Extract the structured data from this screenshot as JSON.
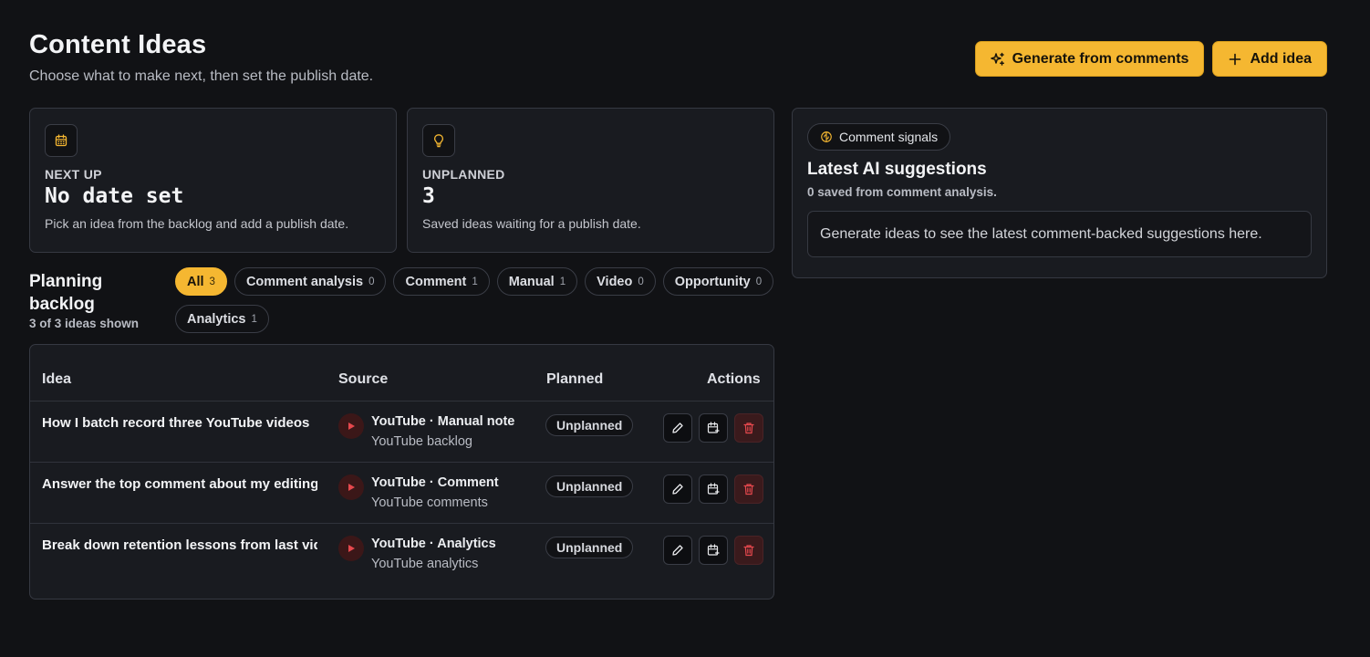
{
  "header": {
    "title": "Content Ideas",
    "subtitle": "Choose what to make next, then set the publish date.",
    "generate_label": "Generate from comments",
    "add_label": "Add idea"
  },
  "stats": [
    {
      "icon": "calendar-icon",
      "label": "NEXT UP",
      "value": "No date set",
      "desc": "Pick an idea from the backlog and add a publish date."
    },
    {
      "icon": "lightbulb-icon",
      "label": "UNPLANNED",
      "value": "3",
      "desc": "Saved ideas waiting for a publish date."
    }
  ],
  "ai": {
    "pill": "Comment signals",
    "title": "Latest AI suggestions",
    "subtitle": "0 saved from comment analysis.",
    "empty": "Generate ideas to see the latest comment-backed suggestions here."
  },
  "backlog": {
    "title": "Planning backlog",
    "count": "3 of 3 ideas shown",
    "filters": [
      {
        "label": "All",
        "count": "3",
        "active": true
      },
      {
        "label": "Comment analysis",
        "count": "0"
      },
      {
        "label": "Comment",
        "count": "1"
      },
      {
        "label": "Manual",
        "count": "1"
      },
      {
        "label": "Video",
        "count": "0"
      },
      {
        "label": "Opportunity",
        "count": "0"
      },
      {
        "label": "Analytics",
        "count": "1"
      }
    ]
  },
  "table": {
    "headers": {
      "idea": "Idea",
      "source": "Source",
      "planned": "Planned",
      "actions": "Actions"
    },
    "rows": [
      {
        "idea": "How I batch record three YouTube videos",
        "source": "YouTube · Manual note",
        "source_sub": "YouTube backlog",
        "planned": "Unplanned"
      },
      {
        "idea": "Answer the top comment about my editing",
        "source": "YouTube · Comment",
        "source_sub": "YouTube comments",
        "planned": "Unplanned"
      },
      {
        "idea": "Break down retention lessons from last video",
        "source": "YouTube · Analytics",
        "source_sub": "YouTube analytics",
        "planned": "Unplanned"
      }
    ]
  },
  "colors": {
    "accent": "#f5b731",
    "background": "#111215",
    "card": "#191b20",
    "danger": "#e5484d"
  }
}
